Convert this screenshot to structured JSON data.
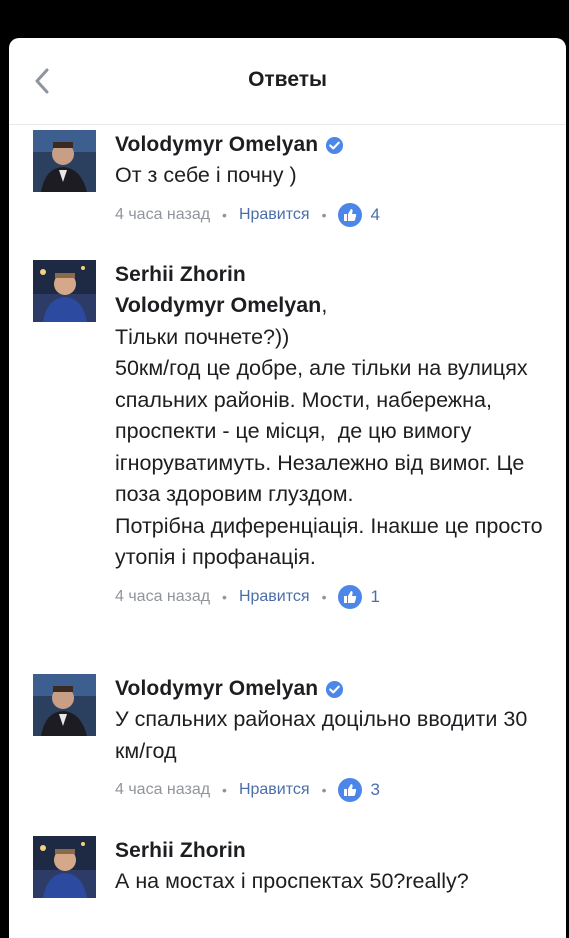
{
  "header": {
    "title": "Ответы",
    "back_icon": "chevron-left-icon"
  },
  "colors": {
    "like_blue": "#4b86e8",
    "link_blue": "#4b6ea9",
    "meta_gray": "#90949c",
    "verified_blue": "#4b86e8"
  },
  "comments": [
    {
      "author": "Volodymyr Omelyan",
      "verified": true,
      "mention": "",
      "text": "От з себе і почну )",
      "time": "4 часа назад",
      "like_label": "Нравится",
      "likes": "4"
    },
    {
      "author": "Serhii Zhorin",
      "verified": false,
      "mention": "Volodymyr Omelyan",
      "text": ",\nТільки почнете?))\n50км/год це добре, але тільки на вулицях спальних районів. Мости, набережна, проспекти - це місця,  де цю вимогу ігноруватимуть. Незалежно від вимог. Це поза здоровим глуздом.\nПотрібна диференціація. Інакше це просто утопія і профанація.",
      "time": "4 часа назад",
      "like_label": "Нравится",
      "likes": "1"
    },
    {
      "author": "Volodymyr Omelyan",
      "verified": true,
      "mention": "",
      "text": "У спальних районах доцільно вводити 30 км/год",
      "time": "4 часа назад",
      "like_label": "Нравится",
      "likes": "3"
    },
    {
      "author": "Serhii Zhorin",
      "verified": false,
      "mention": "",
      "text": "А на мостах і проспектах 50?really?",
      "time": "",
      "like_label": "",
      "likes": ""
    }
  ]
}
